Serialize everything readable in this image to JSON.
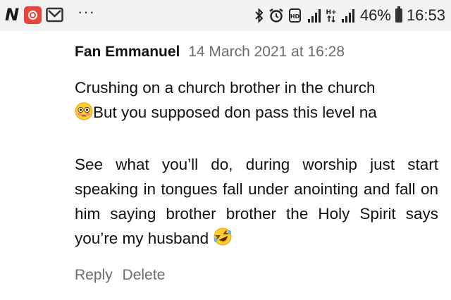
{
  "status_bar": {
    "app_icons": [
      "n-app-icon",
      "camera-app-icon",
      "gmail-icon"
    ],
    "more": "···",
    "status_icons": [
      "bluetooth-icon",
      "alarm-icon",
      "volte-icon",
      "signal-icon",
      "data-icon",
      "signal-icon"
    ],
    "battery_percent": "46%",
    "time": "16:53"
  },
  "comment": {
    "author": "Fan Emmanuel",
    "timestamp": "14 March 2021 at 16:28",
    "paragraph_1_line_1": "Crushing on a church brother in the church",
    "paragraph_1_emoji": "flushed-face-emoji",
    "paragraph_1_line_2": "But you supposed don pass this level na",
    "paragraph_2": "See what you’ll do, during worship just start speaking in tongues fall under anointing and fall on him saying brother brother the Holy Spirit says you’re my husband",
    "paragraph_2_emoji": "rolling-laughing-emoji",
    "actions": {
      "reply": "Reply",
      "delete": "Delete"
    }
  }
}
